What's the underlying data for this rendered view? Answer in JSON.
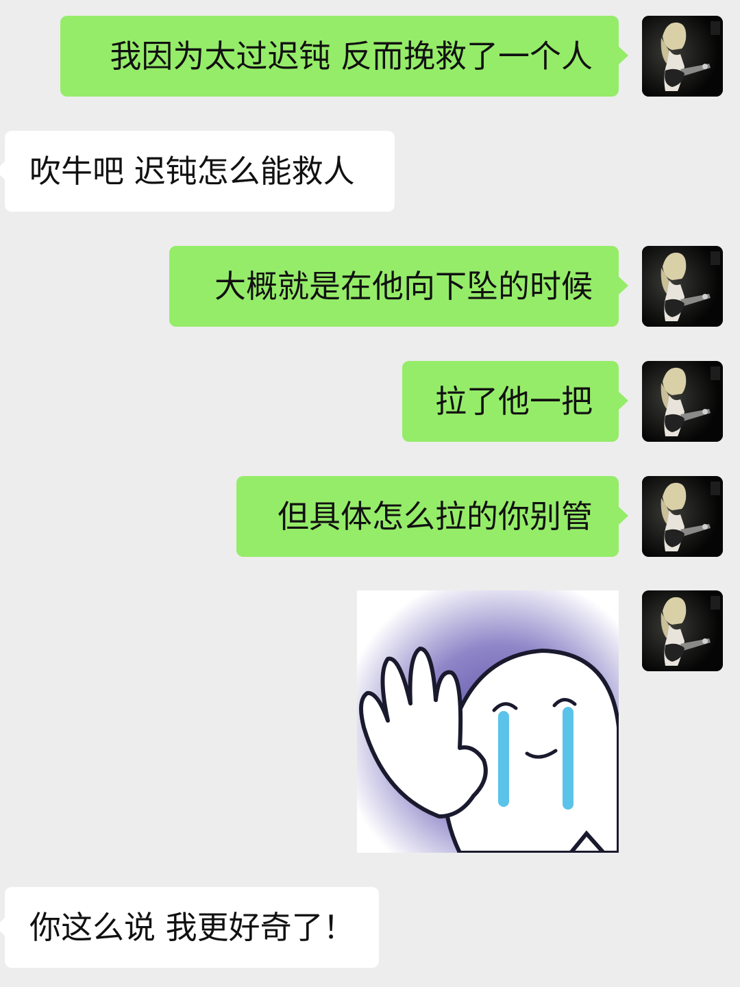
{
  "chat": {
    "messages": [
      {
        "side": "out",
        "text": "我因为太过迟钝 反而挽救了一个人"
      },
      {
        "side": "in",
        "text": "吹牛吧 迟钝怎么能救人"
      },
      {
        "side": "out",
        "text": "大概就是在他向下坠的时候"
      },
      {
        "side": "out",
        "text": "拉了他一把"
      },
      {
        "side": "out",
        "text": "但具体怎么拉的你别管"
      },
      {
        "side": "out",
        "type": "sticker",
        "sticker": "crying-wave-sticker"
      },
      {
        "side": "in",
        "text": "你这么说 我更好奇了！"
      }
    ],
    "self_avatar": "guitarist-photo-avatar",
    "colors": {
      "background": "#ededed",
      "outgoing_bubble": "#95ec69",
      "incoming_bubble": "#ffffff",
      "text": "#111111"
    }
  }
}
